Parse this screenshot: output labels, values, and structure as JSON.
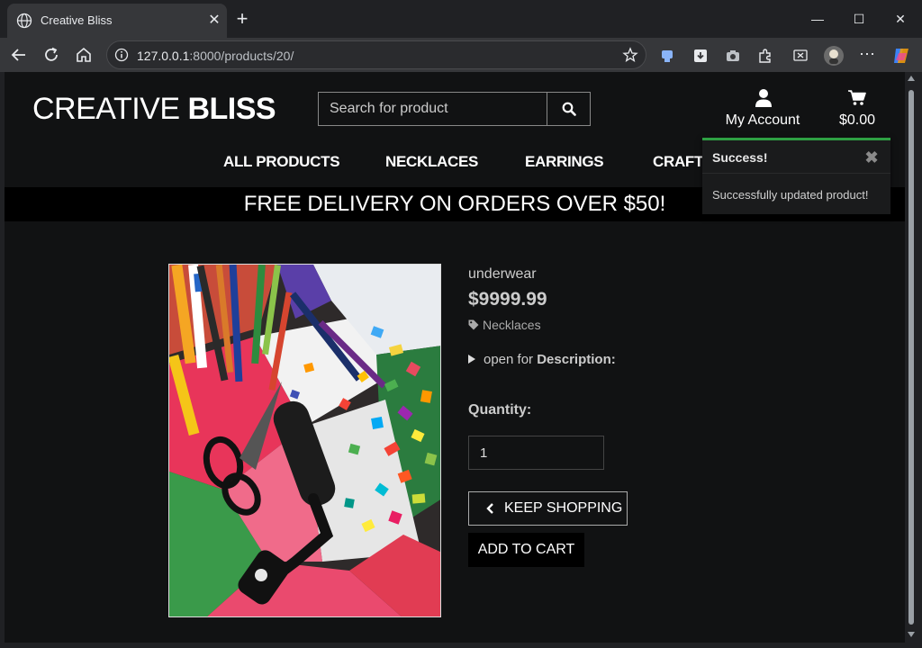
{
  "browser": {
    "tab_title": "Creative Bliss",
    "url_host": "127.0.0.1",
    "url_path": ":8000/products/20/"
  },
  "site": {
    "logo_light": "CREATIVE ",
    "logo_bold": "BLISS",
    "search_placeholder": "Search for product",
    "account_label": "My Account",
    "cart_total": "$0.00",
    "nav": [
      "ALL PRODUCTS",
      "NECKLACES",
      "EARRINGS",
      "CRAFTS"
    ],
    "banner": "FREE DELIVERY ON ORDERS OVER $50!"
  },
  "toast": {
    "title": "Success!",
    "message": "Successfully updated product!",
    "accent": "#2ea043"
  },
  "product": {
    "name": "underwear",
    "price": "$9999.99",
    "category": "Necklaces",
    "desc_prefix": "open for ",
    "desc_label": "Description:",
    "quantity_label": "Quantity:",
    "quantity_value": "1",
    "keep_shopping": "KEEP SHOPPING",
    "add_to_cart": "ADD TO CART"
  }
}
